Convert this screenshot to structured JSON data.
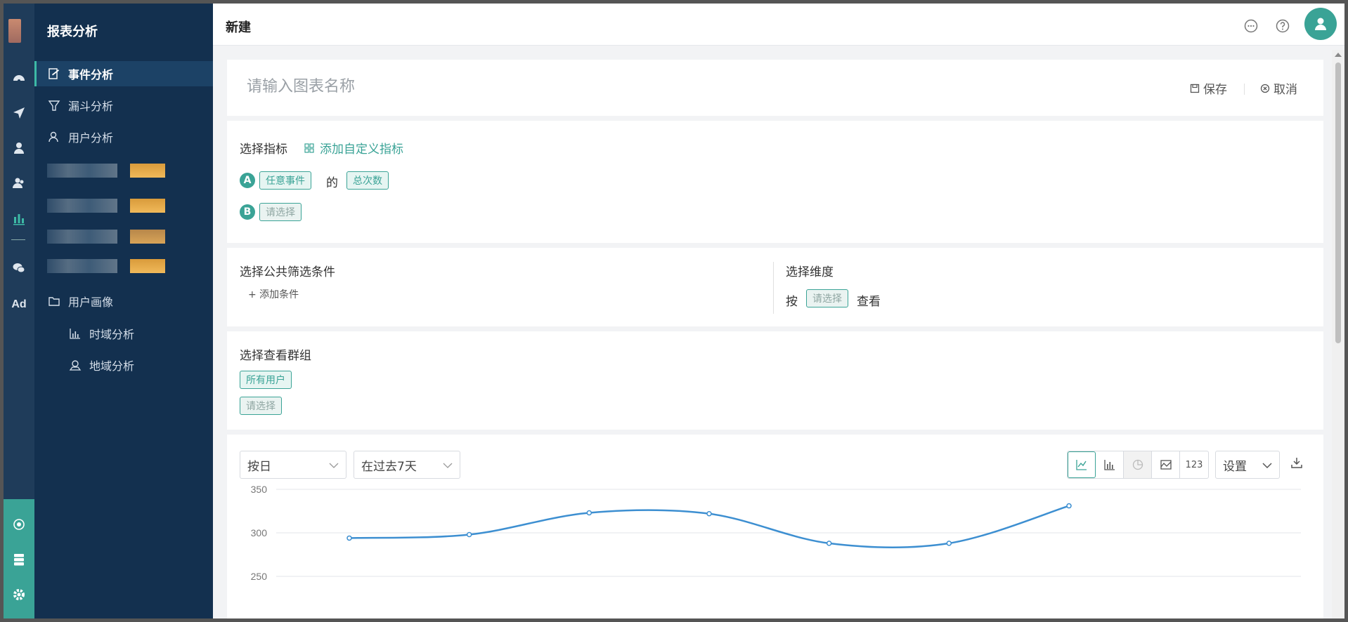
{
  "sidebar": {
    "title": "报表分析",
    "items": [
      {
        "label": "事件分析"
      },
      {
        "label": "漏斗分析"
      },
      {
        "label": "用户分析"
      },
      {
        "label": "用户画像"
      },
      {
        "label": "时域分析"
      },
      {
        "label": "地域分析"
      }
    ]
  },
  "rail": {
    "ad_label": "Ad"
  },
  "header": {
    "title": "新建"
  },
  "name_card": {
    "placeholder": "请输入图表名称",
    "save_label": "保存",
    "cancel_label": "取消"
  },
  "metrics": {
    "title": "选择指标",
    "add_custom": "添加自定义指标",
    "rows": [
      {
        "letter": "A",
        "event": "任意事件",
        "connector": "的",
        "measure": "总次数"
      },
      {
        "letter": "B",
        "event": "请选择"
      }
    ]
  },
  "filters": {
    "title": "选择公共筛选条件",
    "add_label": "+ 添加条件"
  },
  "dimension": {
    "title": "选择维度",
    "prefix": "按",
    "select": "请选择",
    "suffix": "查看"
  },
  "groups": {
    "title": "选择查看群组",
    "all_users": "所有用户",
    "select": "请选择"
  },
  "chart_toolbar": {
    "granularity": "按日",
    "range": "在过去7天",
    "type_buttons": [
      "line-chart-icon",
      "bar-chart-icon",
      "pie-chart-icon",
      "area-chart-icon",
      "123"
    ],
    "settings": "设置"
  },
  "colors": {
    "accent": "#3aa396",
    "sidebar": "#13304f",
    "line": "#3d8fd1"
  },
  "chart_data": {
    "type": "line",
    "x": [
      1,
      2,
      3,
      4,
      5,
      6,
      7
    ],
    "series": [
      {
        "values": [
          294,
          298,
          323,
          322,
          288,
          288,
          331
        ]
      }
    ],
    "ytick_labels": [
      "350",
      "300",
      "250"
    ],
    "ylim": [
      250,
      350
    ],
    "grid": true
  }
}
